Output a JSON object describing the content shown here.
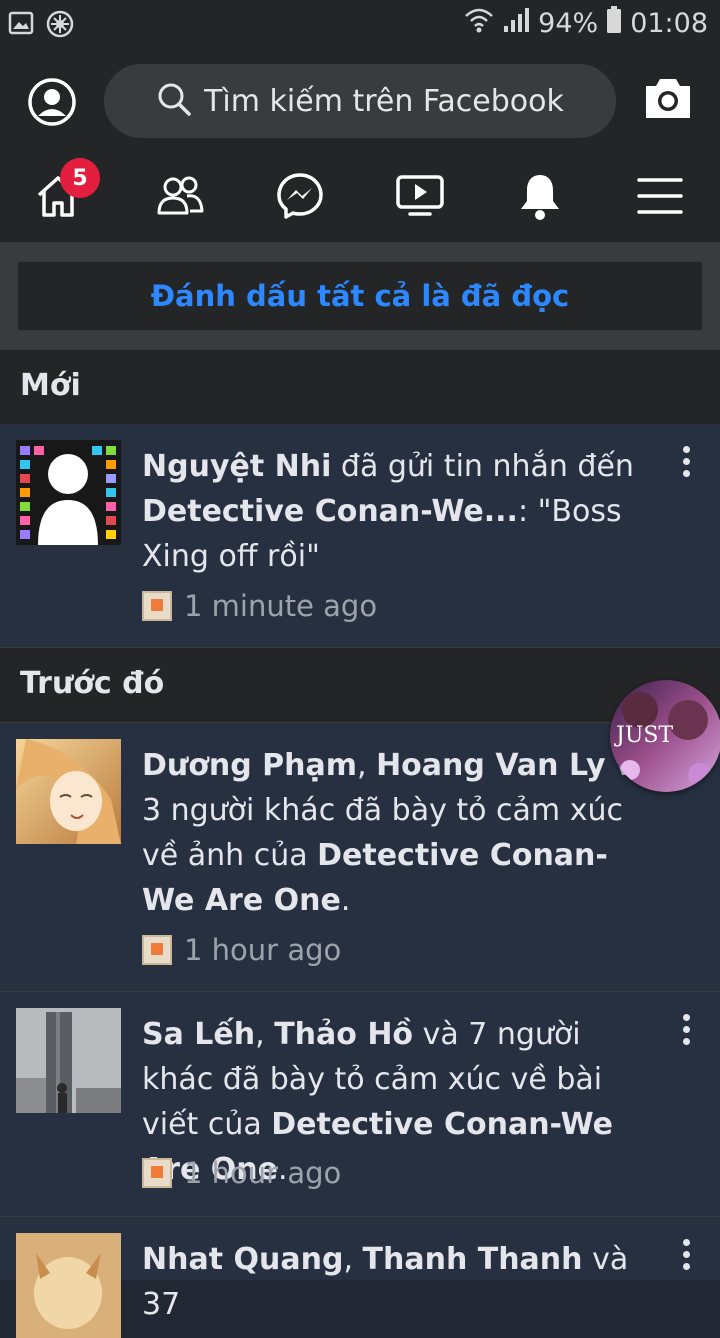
{
  "statusbar": {
    "battery": "94%",
    "time": "01:08",
    "icons": [
      "gallery-icon",
      "settings-flower-icon",
      "wifi-icon",
      "signal-icon",
      "battery-icon"
    ]
  },
  "header": {
    "search_placeholder": "Tìm kiếm trên Facebook",
    "icons": [
      "profile-icon",
      "search-icon",
      "camera-icon"
    ]
  },
  "nav": {
    "items": [
      "home-icon",
      "friends-icon",
      "messenger-icon",
      "watch-icon",
      "bell-icon",
      "menu-icon"
    ],
    "home_badge": "5"
  },
  "mark_all": {
    "label": "Đánh dấu tất cả là đã đọc"
  },
  "sections": {
    "new_title": "Mới",
    "earlier_title": "Trước đó"
  },
  "notifications": [
    {
      "bold1": "Nguyệt Nhi",
      "t1": " đã gửi tin nhắn đến ",
      "bold2": "Detective Conan-We...",
      "t2": ": \"Boss Xing off rồi\"",
      "time": "1 minute ago"
    },
    {
      "bold1": "Dương Phạm",
      "sep": ", ",
      "bold2": "Hoang Van Ly",
      "t1": " và 3 người khác đã bày tỏ cảm xúc về ảnh của ",
      "bold3": "Detective Conan-We Are One",
      "t2": ".",
      "time": "1 hour ago"
    },
    {
      "bold1": "Sa Lếh",
      "sep": ", ",
      "bold2": "Thảo Hồ",
      "t1": " và 7 người khác đã bày tỏ cảm xúc về bài viết của ",
      "bold3": "Detective Conan-We Are One",
      "t2": ".",
      "time": "1 hour ago"
    },
    {
      "bold1": "Nhat Quang",
      "sep": ", ",
      "bold2": "Thanh Thanh",
      "t1": " và 37",
      "time": ""
    }
  ],
  "chathead": {
    "text": "JUST"
  }
}
